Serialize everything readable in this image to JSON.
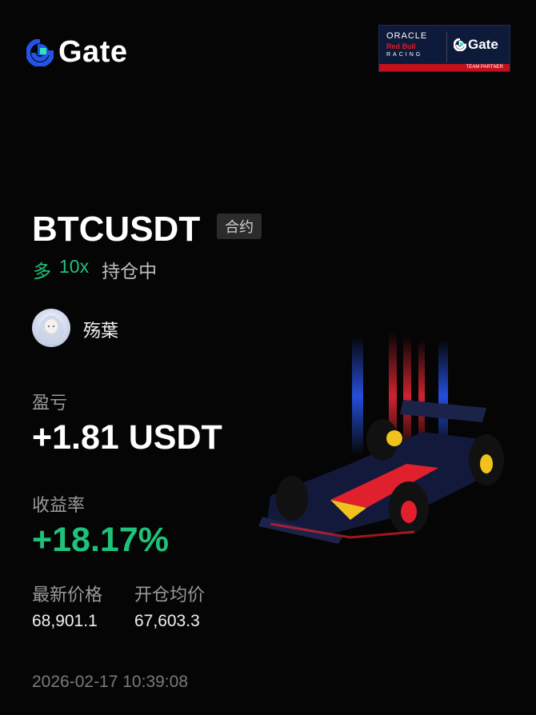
{
  "brand": {
    "name": "Gate"
  },
  "partner": {
    "line1": "ORACLE",
    "line2": "Red Bull",
    "line3": "RACING",
    "brand": "Gate",
    "tag": "TEAM PARTNER"
  },
  "trade": {
    "pair": "BTCUSDT",
    "type_badge": "合约",
    "side": "多",
    "leverage": "10x",
    "status": "持仓中"
  },
  "user": {
    "name": "殇葉"
  },
  "pnl": {
    "label": "盈亏",
    "value": "+1.81 USDT"
  },
  "roi": {
    "label": "收益率",
    "value": "+18.17%"
  },
  "prices": {
    "last_label": "最新价格",
    "last_value": "68,901.1",
    "entry_label": "开仓均价",
    "entry_value": "67,603.3"
  },
  "timestamp": "2026-02-17 10:39:08",
  "colors": {
    "accent_green": "#1fc27a",
    "brand_blue": "#2354e6",
    "background": "#050505"
  }
}
